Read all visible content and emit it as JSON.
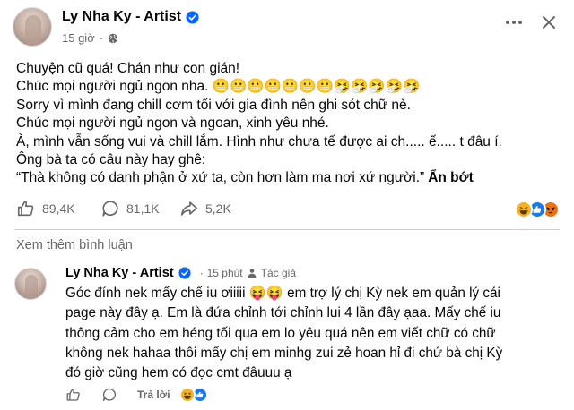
{
  "post": {
    "author": "Ly Nha Ky - Artist",
    "time": "15 giờ",
    "lines": [
      "Chuyện cũ quá! Chán như con gián!",
      "Chúc mọi người ngủ ngon nha. 😬😬😬😬😬😬😬🤧🤧🤧🤧🤧",
      "Sorry vì mình đang chill cơm tối với gia đình nên ghi sót chữ nè.",
      "Chúc mọi người ngủ ngon và ngoan, xinh yêu nhé.",
      "À, mình vẫn sống vui và chill lắm. Hình như chưa tế được ai ch..... ế..... t đâu í.",
      "Ông bà ta có câu này hay ghê:",
      "“Thà không có danh phận ở xứ ta, còn hơn làm ma nơi xứ người.”"
    ],
    "see_less": "Ẩn bớt"
  },
  "actions": {
    "likes": "89,4K",
    "comments": "81,1K",
    "shares": "5,2K"
  },
  "reactions": [
    "haha-icon",
    "like-icon",
    "angry-icon"
  ],
  "view_more_comments": "Xem thêm bình luận",
  "comment": {
    "author": "Ly Nha Ky - Artist",
    "time": "15 phút",
    "badge": "Tác giả",
    "lines": [
      "Góc đính nek mấy chế iu ơiiiii 😝😝 em trợ lý chị Kỳ nek em quản lý cái",
      "page này đây ạ. Em là đứa chỉnh tới chỉnh lui 4 lần đây ạaa. Mấy chế iu",
      "thông cảm cho em héng tối qua em lo yêu quá nên em viết chữ có chữ",
      "không nek hahaa thôi mấy chị em minhg zui zẻ hoan hỉ đi chứ bà chị Kỳ",
      "đó giờ cũng hem có đọc cmt đâuuu ạ"
    ],
    "reply_label": "Trả lời"
  },
  "colors": {
    "verified": "#0866ff",
    "like": "#1877f2",
    "haha": "#f7b125",
    "angry": "#e9710f",
    "secondary_text": "#65676b"
  }
}
